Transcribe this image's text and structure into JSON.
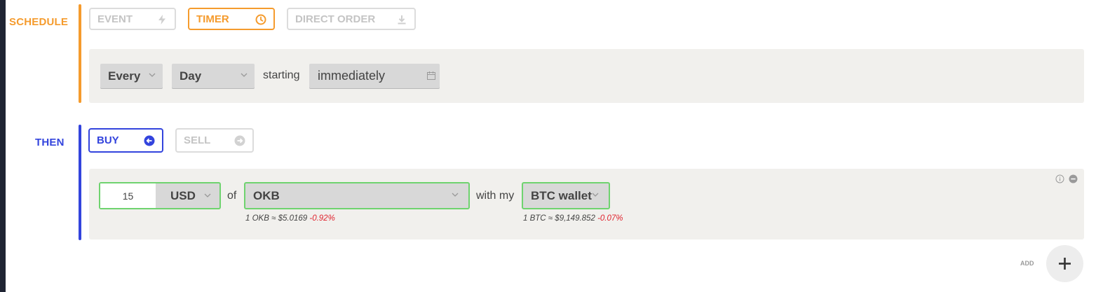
{
  "colors": {
    "schedule": "#f59b2d",
    "then": "#3344dd",
    "negative": "#e0242f",
    "valid": "#6fd36f"
  },
  "schedule": {
    "label": "SCHEDULE",
    "tabs": [
      {
        "label": "EVENT",
        "icon": "lightning-icon",
        "active": false
      },
      {
        "label": "TIMER",
        "icon": "clock-icon",
        "active": true
      },
      {
        "label": "DIRECT ORDER",
        "icon": "download-icon",
        "active": false
      }
    ],
    "frequency": "Every",
    "period": "Day",
    "starting_label": "starting",
    "start_value": "immediately"
  },
  "then": {
    "label": "THEN",
    "tabs": [
      {
        "label": "BUY",
        "icon": "arrow-left-circle-icon",
        "active": true
      },
      {
        "label": "SELL",
        "icon": "arrow-right-circle-icon",
        "active": false
      }
    ],
    "amount": "15",
    "currency": "USD",
    "of_label": "of",
    "asset": "OKB",
    "asset_rate": "1 OKB ≈ $5.0169",
    "asset_change": "-0.92%",
    "with_label": "with my",
    "wallet": "BTC wallet",
    "wallet_rate": "1 BTC ≈ $9,149.852",
    "wallet_change": "-0.07%"
  },
  "add": {
    "label": "ADD",
    "icon": "plus-icon"
  }
}
